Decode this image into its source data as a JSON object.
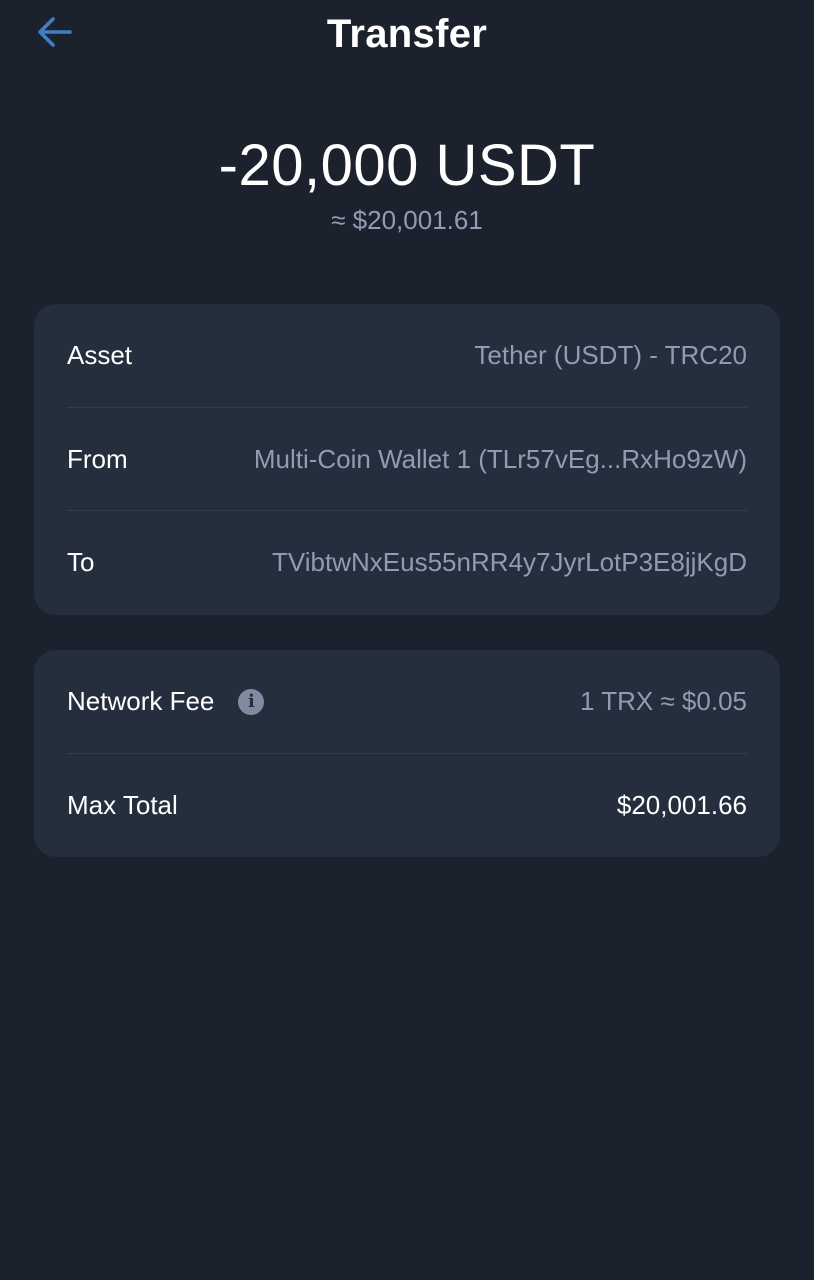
{
  "header": {
    "title": "Transfer"
  },
  "summary": {
    "amount": "-20,000 USDT",
    "fiat_equivalent": "≈ $20,001.61"
  },
  "details": {
    "asset_label": "Asset",
    "asset_value": "Tether (USDT) - TRC20",
    "from_label": "From",
    "from_value": "Multi-Coin Wallet 1 (TLr57vEg...RxHo9zW)",
    "to_label": "To",
    "to_value": "TVibtwNxEus55nRR4y7JyrLotP3E8jjKgD"
  },
  "fees": {
    "network_fee_label": "Network Fee",
    "network_fee_value": "1 TRX ≈ $0.05",
    "max_total_label": "Max Total",
    "max_total_value": "$20,001.66"
  },
  "icons": {
    "back": "arrow-left-icon",
    "info": "info-icon"
  },
  "colors": {
    "background": "#1b222d",
    "card": "#242e3d",
    "accent": "#3d7fc4",
    "muted_text": "#8f9cb4"
  }
}
